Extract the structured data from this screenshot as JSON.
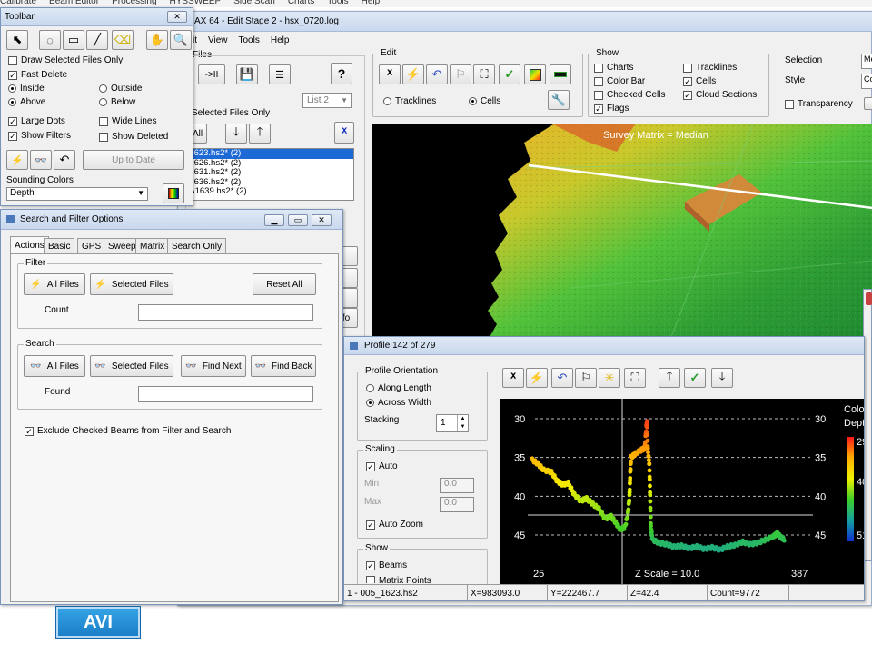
{
  "menubar_top": {
    "items": [
      "Calibrate",
      "Beam Editor",
      "Processing",
      "HYSSWEEP",
      "Side Scan",
      "Charts",
      "Tools",
      "Help"
    ]
  },
  "main": {
    "title": "AX 64 - Edit Stage 2 - hsx_0720.log",
    "menu": [
      "it",
      "View",
      "Tools",
      "Help"
    ],
    "files_label": "Files",
    "play_label": "->II",
    "list_select": "List 2",
    "show_selected_only": "w Selected Files Only",
    "all_btn": "t All",
    "files": [
      "_1623.hs2* (2)",
      "_1626.hs2* (2)",
      "_1631.hs2* (2)",
      "_1636.hs2* (2)",
      "LA1639.hs2* (2)"
    ],
    "side_btn_fragment": "fo"
  },
  "edit_group": {
    "label": "Edit",
    "radios": [
      {
        "label": "Tracklines",
        "on": false
      },
      {
        "label": "Cells",
        "on": true
      }
    ]
  },
  "show_group": {
    "label": "Show",
    "col1": [
      {
        "label": "Charts",
        "checked": false
      },
      {
        "label": "Color Bar",
        "checked": false
      },
      {
        "label": "Checked Cells",
        "checked": false
      },
      {
        "label": "Flags",
        "checked": true
      }
    ],
    "col2": [
      {
        "label": "Tracklines",
        "checked": false
      },
      {
        "label": "Cells",
        "checked": true
      },
      {
        "label": "Cloud Sections",
        "checked": true
      }
    ]
  },
  "selection_panel": {
    "selection_label": "Selection",
    "selection_value": "Me",
    "style_label": "Style",
    "style_value": "Co",
    "transparency_label": "Transparency"
  },
  "view3d": {
    "caption": "Survey Matrix = Median"
  },
  "toolbar_win": {
    "title": "Toolbar",
    "draw_selected": "Draw Selected Files Only",
    "fast_delete": "Fast Delete",
    "inside": "Inside",
    "outside": "Outside",
    "above": "Above",
    "below": "Below",
    "large_dots": "Large Dots",
    "wide_lines": "Wide Lines",
    "show_filters": "Show Filters",
    "show_deleted": "Show Deleted",
    "up_to_date": "Up to Date",
    "sounding_colors": "Sounding Colors",
    "sounding_value": "Depth"
  },
  "filter_win": {
    "title": "Search and Filter Options",
    "tabs": [
      "Actions",
      "Basic",
      "GPS",
      "Sweep",
      "Matrix",
      "Search Only"
    ],
    "filter_label": "Filter",
    "all_files": "All Files",
    "selected_files": "Selected Files",
    "reset_all": "Reset All",
    "count_label": "Count",
    "count_value": "",
    "search_label": "Search",
    "find_next": "Find Next",
    "find_back": "Find Back",
    "found_label": "Found",
    "found_value": "",
    "exclude_label": "Exclude Checked Beams from Filter and Search"
  },
  "profile_win": {
    "title": "Profile 142 of 279",
    "orientation_label": "Profile Orientation",
    "along": "Along Length",
    "across": "Across Width",
    "stacking_label": "Stacking",
    "stacking_value": "1",
    "scaling_label": "Scaling",
    "auto": "Auto",
    "min_label": "Min",
    "min_value": "0.0",
    "max_label": "Max",
    "max_value": "0.0",
    "auto_zoom": "Auto Zoom",
    "show_label": "Show",
    "beams": "Beams",
    "matrix_points": "Matrix Points",
    "z_scale": "Z Scale = 10.0",
    "x_left": "25",
    "x_right": "387",
    "colorbar_title": "Colo",
    "colorbar_sub": "Dept",
    "colorbar_ticks": [
      "29",
      "40",
      "51"
    ],
    "status": {
      "file": "1 - 005_1623.hs2",
      "x": "X=983093.0",
      "y": "Y=222467.7",
      "z": "Z=42.4",
      "count": "Count=9772"
    }
  },
  "avi_button": "AVI",
  "chart_data": {
    "type": "scatter",
    "ylim": [
      30,
      46
    ],
    "yticks": [
      30,
      35,
      40,
      45
    ],
    "x_range_labels": [
      "25",
      "387"
    ],
    "series": [
      {
        "points": [
          [
            25,
            35.3
          ],
          [
            32,
            35.8
          ],
          [
            40,
            36.6
          ],
          [
            50,
            36.9
          ],
          [
            58,
            38.1
          ],
          [
            65,
            38.5
          ],
          [
            72,
            38.3
          ],
          [
            80,
            39.8
          ],
          [
            88,
            40.6
          ],
          [
            96,
            40.3
          ],
          [
            104,
            41.0
          ],
          [
            112,
            41.6
          ],
          [
            120,
            42.9
          ],
          [
            128,
            42.6
          ],
          [
            134,
            43.4
          ],
          [
            140,
            44.3
          ],
          [
            146,
            44.0
          ],
          [
            150,
            42.3
          ],
          [
            152,
            40.0
          ],
          [
            153,
            37.0
          ],
          [
            154,
            35.0
          ],
          [
            160,
            34.5
          ],
          [
            168,
            34.0
          ],
          [
            172,
            33.8
          ],
          [
            174,
            31.0
          ],
          [
            175,
            30.5
          ],
          [
            176,
            34.0
          ],
          [
            178,
            36.0
          ],
          [
            179,
            40.0
          ],
          [
            180,
            44.0
          ],
          [
            182,
            45.6
          ],
          [
            190,
            46.0
          ],
          [
            200,
            46.2
          ],
          [
            210,
            46.5
          ],
          [
            220,
            46.4
          ],
          [
            230,
            46.7
          ],
          [
            240,
            46.5
          ],
          [
            250,
            46.8
          ],
          [
            260,
            46.6
          ],
          [
            270,
            46.9
          ],
          [
            280,
            46.5
          ],
          [
            290,
            46.3
          ],
          [
            300,
            45.9
          ],
          [
            310,
            46.2
          ],
          [
            320,
            46.0
          ],
          [
            330,
            45.6
          ],
          [
            340,
            45.2
          ],
          [
            345,
            44.8
          ],
          [
            350,
            45.3
          ],
          [
            355,
            45.6
          ]
        ]
      }
    ]
  }
}
